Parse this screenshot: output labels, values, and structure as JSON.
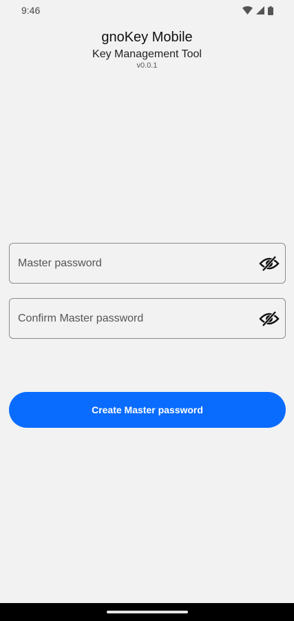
{
  "status_bar": {
    "time": "9:46",
    "icons": [
      "wifi-icon",
      "cell-signal-icon",
      "battery-icon"
    ]
  },
  "header": {
    "title": "gnoKey Mobile",
    "subtitle": "Key Management Tool",
    "version": "v0.0.1"
  },
  "form": {
    "master_password": {
      "placeholder": "Master password",
      "value": "",
      "toggle_icon": "eye-off-icon"
    },
    "confirm_password": {
      "placeholder": "Confirm Master password",
      "value": "",
      "toggle_icon": "eye-off-icon"
    },
    "submit_label": "Create Master password"
  },
  "colors": {
    "background": "#f2f2f2",
    "accent": "#0a6cff",
    "button_text": "#ffffff",
    "field_border": "#8a8a8a",
    "nav_bar": "#000000"
  }
}
